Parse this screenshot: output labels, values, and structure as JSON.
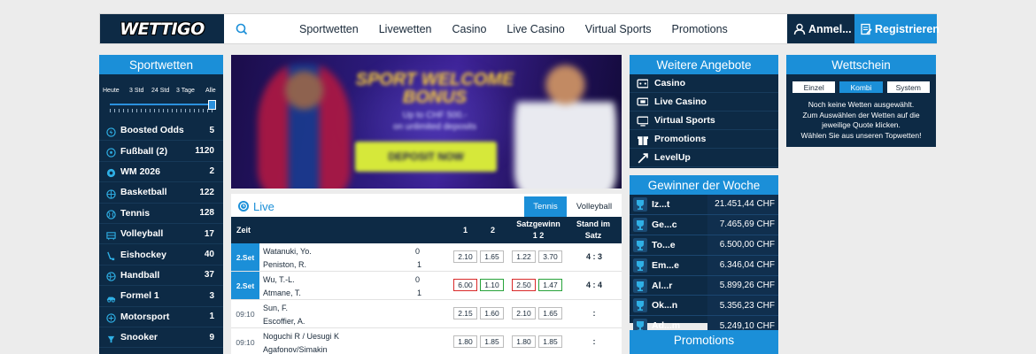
{
  "brand": {
    "logo_text": "WETTIGO"
  },
  "header": {
    "nav": [
      "Sportwetten",
      "Livewetten",
      "Casino",
      "Live Casino",
      "Virtual Sports",
      "Promotions"
    ],
    "login_label": "Anmel...",
    "register_label": "Registrieren"
  },
  "sidebar": {
    "title": "Sportwetten",
    "time_filter": {
      "labels": [
        "Heute",
        "3 Std",
        "24 Std",
        "3 Tage",
        "Alle"
      ],
      "selected": "Alle"
    },
    "items": [
      {
        "label": "Boosted Odds",
        "count": "5",
        "icon": "boost-icon"
      },
      {
        "label": "Fußball (2)",
        "count": "1120",
        "icon": "soccer-ball-icon"
      },
      {
        "label": "WM 2026",
        "count": "2",
        "icon": "world-cup-icon"
      },
      {
        "label": "Basketball",
        "count": "122",
        "icon": "basketball-icon"
      },
      {
        "label": "Tennis",
        "count": "128",
        "icon": "tennis-icon"
      },
      {
        "label": "Volleyball",
        "count": "17",
        "icon": "volleyball-icon"
      },
      {
        "label": "Eishockey",
        "count": "40",
        "icon": "ice-hockey-icon"
      },
      {
        "label": "Handball",
        "count": "37",
        "icon": "handball-icon"
      },
      {
        "label": "Formel 1",
        "count": "3",
        "icon": "formula1-icon"
      },
      {
        "label": "Motorsport",
        "count": "1",
        "icon": "motorsport-icon"
      },
      {
        "label": "Snooker",
        "count": "9",
        "icon": "snooker-icon"
      }
    ]
  },
  "banner": {
    "title": "SPORT WELCOME BONUS",
    "subtitle_line1": "Up to CHF 500.-",
    "subtitle_line2": "on unlimited deposits",
    "cta": "DEPOSIT NOW"
  },
  "live": {
    "title": "Live",
    "tabs": [
      "Tennis",
      "Volleyball"
    ],
    "active_tab": "Tennis",
    "columns": {
      "time": "Zeit",
      "c1": "1",
      "c2": "2",
      "set_winner": "Satzgewinn",
      "set_winner_sub": "1 2",
      "status": "Stand im",
      "status_sub": "Satz"
    },
    "matches": [
      {
        "time": "2.Set",
        "live": true,
        "player1": "Watanuki, Yo.",
        "player2": "Peniston, R.",
        "score1": "0",
        "score2": "1",
        "odds": [
          "2.10",
          "1.65",
          "1.22",
          "3.70"
        ],
        "trend": [
          "",
          "",
          "",
          ""
        ],
        "status": "4 : 3"
      },
      {
        "time": "2.Set",
        "live": true,
        "player1": "Wu, T.-L.",
        "player2": "Atmane, T.",
        "score1": "0",
        "score2": "1",
        "odds": [
          "6.00",
          "1.10",
          "2.50",
          "1.47"
        ],
        "trend": [
          "down",
          "up",
          "down",
          "up"
        ],
        "status": "4 : 4"
      },
      {
        "time": "09:10",
        "live": false,
        "player1": "Sun, F.",
        "player2": "Escoffier, A.",
        "score1": "",
        "score2": "",
        "odds": [
          "2.15",
          "1.60",
          "2.10",
          "1.65"
        ],
        "trend": [
          "",
          "",
          "",
          ""
        ],
        "status": ":"
      },
      {
        "time": "09:10",
        "live": false,
        "player1": "Noguchi R / Uesugi K",
        "player2": "Agafonov/Simakin",
        "score1": "",
        "score2": "",
        "odds": [
          "1.80",
          "1.85",
          "1.80",
          "1.85"
        ],
        "trend": [
          "",
          "",
          "",
          ""
        ],
        "status": ":"
      }
    ]
  },
  "offers": {
    "title": "Weitere Angebote",
    "items": [
      {
        "label": "Casino",
        "icon": "casino-icon"
      },
      {
        "label": "Live Casino",
        "icon": "live-casino-icon"
      },
      {
        "label": "Virtual Sports",
        "icon": "virtual-sports-icon"
      },
      {
        "label": "Promotions",
        "icon": "gift-icon"
      },
      {
        "label": "LevelUp",
        "icon": "levelup-icon"
      }
    ]
  },
  "winners": {
    "title": "Gewinner der Woche",
    "rows": [
      {
        "name": "Iz...t",
        "amount": "21.451,44 CHF"
      },
      {
        "name": "Ge...c",
        "amount": "7.465,69 CHF"
      },
      {
        "name": "To...e",
        "amount": "6.500,00 CHF"
      },
      {
        "name": "Em...e",
        "amount": "6.346,04 CHF"
      },
      {
        "name": "Al...r",
        "amount": "5.899,26 CHF"
      },
      {
        "name": "Ok...n",
        "amount": "5.356,23 CHF"
      },
      {
        "name": "Ad...m",
        "amount": "5.249,10 CHF"
      }
    ]
  },
  "promotions": {
    "title": "Promotions"
  },
  "betslip": {
    "title": "Wettschein",
    "tabs": [
      "Einzel",
      "Kombi",
      "System"
    ],
    "active_tab": "Kombi",
    "empty_line1": "Noch keine Wetten ausgewählt.",
    "empty_line2": "Zum Auswählen der Wetten auf die",
    "empty_line3": "jeweilige Quote klicken.",
    "empty_line4": "Wählen Sie aus unseren Topwetten!"
  },
  "colors": {
    "navy": "#0d2a45",
    "accent_blue": "#1b8fd8",
    "odds_down": "#d92a2a",
    "odds_up": "#27a33a"
  }
}
